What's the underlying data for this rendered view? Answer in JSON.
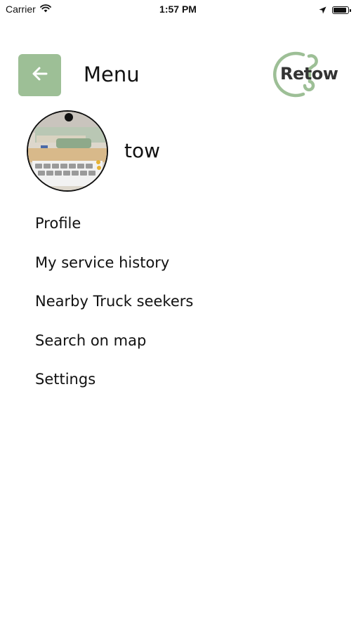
{
  "status_bar": {
    "carrier": "Carrier",
    "time": "1:57 PM",
    "wifi_icon": "wifi-icon",
    "location_icon": "location-arrow-icon",
    "battery_icon": "battery-icon",
    "battery_level": 0.9
  },
  "header": {
    "back_icon": "arrow-left-icon",
    "title": "Menu",
    "logo_text": "Retow",
    "accent_color": "#9dbf96"
  },
  "profile": {
    "name": "tow"
  },
  "menu": {
    "items": [
      {
        "label": "Profile"
      },
      {
        "label": "My service history"
      },
      {
        "label": "Nearby Truck seekers"
      },
      {
        "label": "Search on map"
      },
      {
        "label": "Settings"
      }
    ]
  }
}
